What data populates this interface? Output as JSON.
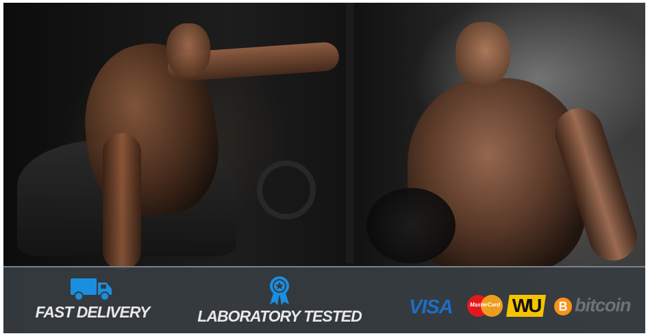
{
  "features": {
    "delivery": {
      "label": "FAST DELIVERY",
      "icon": "delivery-truck-icon"
    },
    "lab": {
      "label": "LABORATORY TESTED",
      "icon": "award-ribbon-icon"
    }
  },
  "payments": {
    "visa": "VISA",
    "mastercard": "MasterCard",
    "western_union": "WU",
    "bitcoin_symbol": "B",
    "bitcoin_word": "bitcoin"
  },
  "colors": {
    "accent_blue": "#1a8fe0",
    "visa_blue": "#1a6fc4",
    "mastercard_red": "#e5171e",
    "mastercard_orange": "#f7a21b",
    "wu_yellow": "#f5c400",
    "bitcoin_orange": "#f7931a",
    "bar_background": "#373c42"
  }
}
